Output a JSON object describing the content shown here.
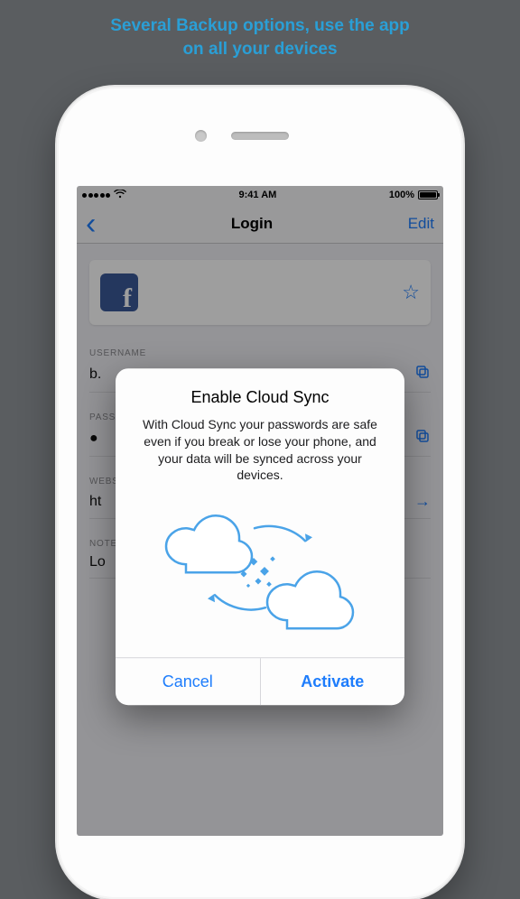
{
  "promo": {
    "line1": "Several Backup options, use the app",
    "line2": "on all your devices"
  },
  "statusbar": {
    "time": "9:41 AM",
    "battery_pct": "100%",
    "wifi": "wifi-icon"
  },
  "navbar": {
    "back_glyph": "‹",
    "title": "Login",
    "edit_label": "Edit"
  },
  "item": {
    "star_glyph": "☆"
  },
  "fields": {
    "username": {
      "label": "USERNAME",
      "value": "b."
    },
    "password": {
      "label": "PASSWORD",
      "value": "●"
    },
    "website": {
      "label": "WEBSITE",
      "value": "ht"
    },
    "note": {
      "label": "NOTE",
      "value": "Lo"
    }
  },
  "modal": {
    "title": "Enable Cloud Sync",
    "body": "With Cloud Sync your passwords are safe even if you break or lose your phone, and your data will be synced across your devices.",
    "cancel_label": "Cancel",
    "activate_label": "Activate"
  },
  "colors": {
    "accent": "#1e7dfc",
    "promo": "#2a9fd6"
  }
}
